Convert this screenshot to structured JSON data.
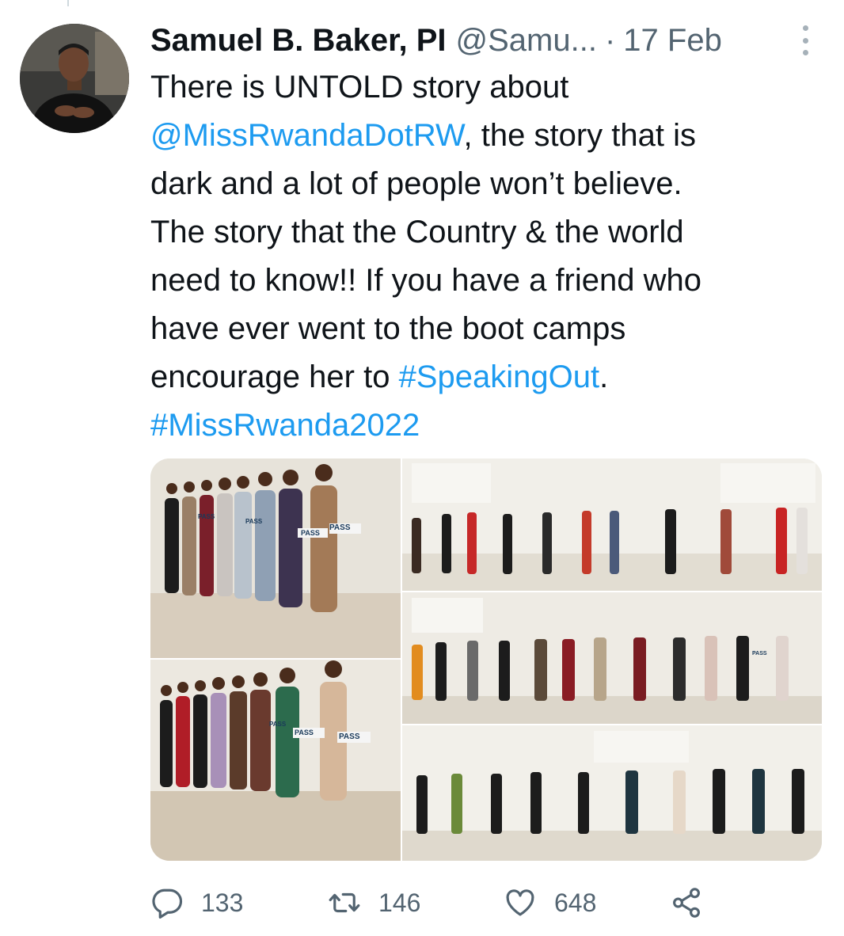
{
  "tweet": {
    "author_name": "Samuel B. Baker, PI",
    "handle": "@Samu...",
    "separator": "·",
    "time": "17 Feb",
    "text_lines": [
      [
        {
          "t": "There is UNTOLD story about",
          "link": false
        }
      ],
      [
        {
          "t": "@MissRwandaDotRW",
          "link": true
        },
        {
          "t": ", the story that is",
          "link": false
        }
      ],
      [
        {
          "t": "dark and a lot of people won’t believe.",
          "link": false
        }
      ],
      [
        {
          "t": "The story that the Country & the world",
          "link": false
        }
      ],
      [
        {
          "t": "need to know!! If you have a friend who",
          "link": false
        }
      ],
      [
        {
          "t": "have ever went to the boot camps",
          "link": false
        }
      ],
      [
        {
          "t": "encourage her to ",
          "link": false
        },
        {
          "t": "#SpeakingOut",
          "link": true
        },
        {
          "t": ".",
          "link": false
        }
      ],
      [
        {
          "t": "#MissRwanda2022",
          "link": true
        }
      ]
    ],
    "media_signs": [
      "PASS",
      "PASS",
      "PASS",
      "PASS",
      "PASS",
      "PASS",
      "PASS",
      "PASS"
    ],
    "actions": {
      "reply_icon": "reply-icon",
      "reply_count": "133",
      "retweet_icon": "retweet-icon",
      "retweet_count": "146",
      "like_icon": "heart-icon",
      "like_count": "648",
      "share_icon": "share-icon"
    }
  },
  "colors": {
    "link": "#1d9bf0",
    "secondary_text": "#536471",
    "primary_text": "#0f1419"
  }
}
